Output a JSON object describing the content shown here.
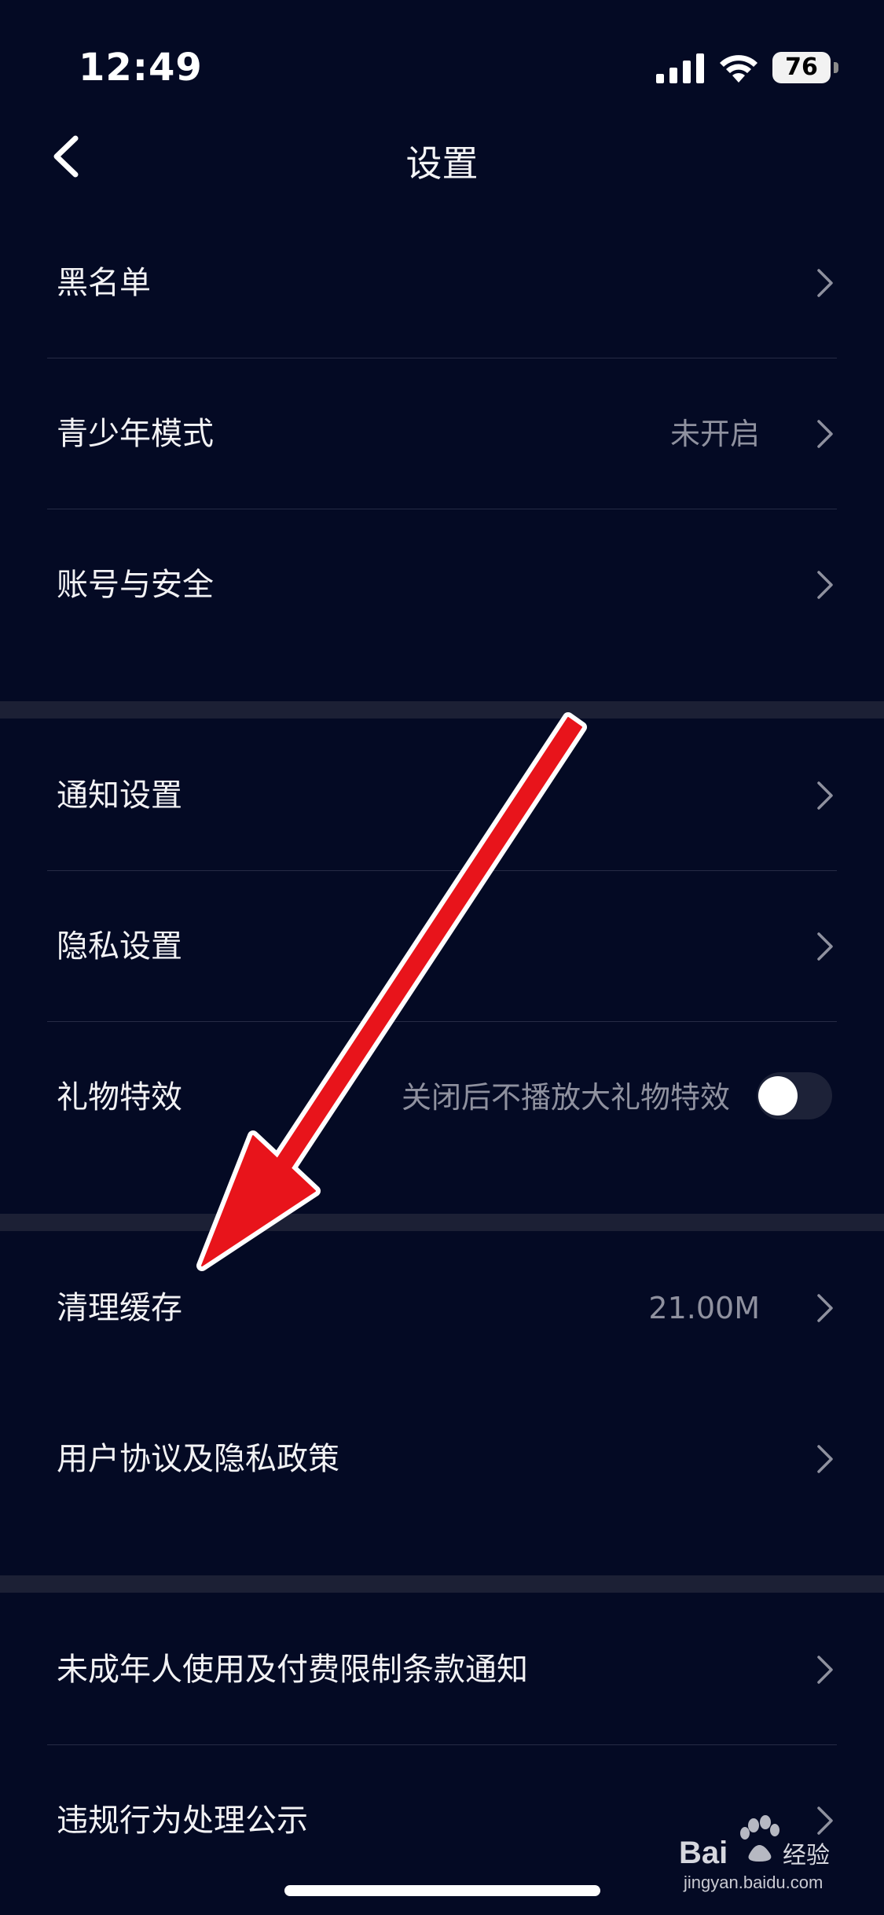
{
  "status_bar": {
    "time": "12:49",
    "battery": "76"
  },
  "nav": {
    "title": "设置"
  },
  "groups": [
    {
      "items": [
        {
          "label": "黑名单"
        },
        {
          "label": "青少年模式",
          "value": "未开启"
        },
        {
          "label": "账号与安全"
        }
      ]
    },
    {
      "items": [
        {
          "label": "通知设置"
        },
        {
          "label": "隐私设置"
        },
        {
          "label": "礼物特效",
          "value": "关闭后不播放大礼物特效",
          "toggle_on": false
        }
      ]
    },
    {
      "items": [
        {
          "label": "清理缓存",
          "value": "21.00M"
        },
        {
          "label": "用户协议及隐私政策"
        }
      ]
    },
    {
      "items": [
        {
          "label": "未成年人使用及付费限制条款通知"
        },
        {
          "label": "违规行为处理公示"
        }
      ]
    }
  ],
  "annotation": {
    "arrow_color": "#e8141b"
  },
  "watermark": {
    "logo_text": "Baidu经验",
    "url": "jingyan.baidu.com"
  }
}
